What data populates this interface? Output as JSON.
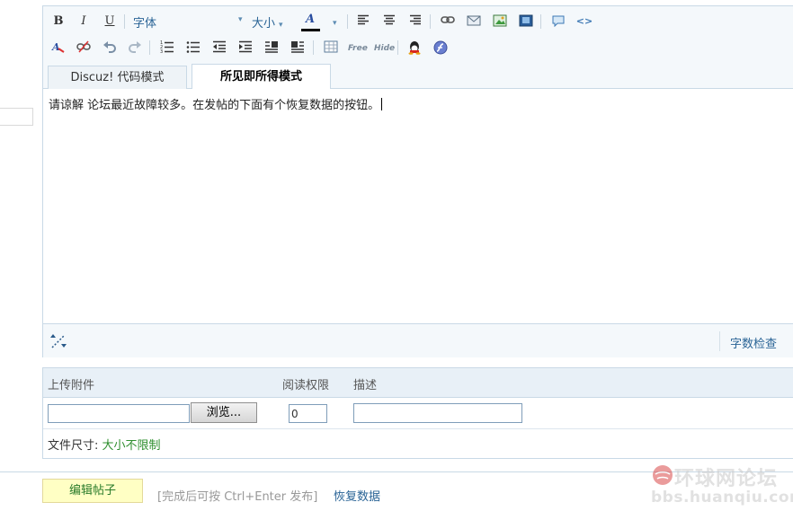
{
  "toolbar": {
    "bold": "B",
    "italic": "I",
    "underline": "U",
    "font_family": "字体",
    "font_size": "大小",
    "font_color": "A"
  },
  "tabs": {
    "code_mode": "Discuz! 代码模式",
    "wysiwyg_mode": "所见即所得模式"
  },
  "editor": {
    "content": "请谅解 论坛最近故障较多。在发帖的下面有个恢复数据的按钮。"
  },
  "footer": {
    "word_count": "字数检查"
  },
  "attachments": {
    "header_upload": "上传附件",
    "header_permission": "阅读权限",
    "header_description": "描述",
    "browse_button": "浏览...",
    "permission_value": "0",
    "filesize_label": "文件尺寸: ",
    "filesize_value": "大小不限制"
  },
  "bottom": {
    "submit_button": "编辑帖子",
    "hint": "[完成后可按 Ctrl+Enter 发布]",
    "restore_link": "恢复数据"
  },
  "watermark": {
    "line1": "环球网论坛",
    "line2": "bbs.huanqiu.com"
  },
  "colors": {
    "link": "#2a6496",
    "toolbar_bg": "#f4f8fb",
    "border": "#c9d9e6",
    "submit_bg": "#ffffc4",
    "green": "#2f8f2f"
  }
}
